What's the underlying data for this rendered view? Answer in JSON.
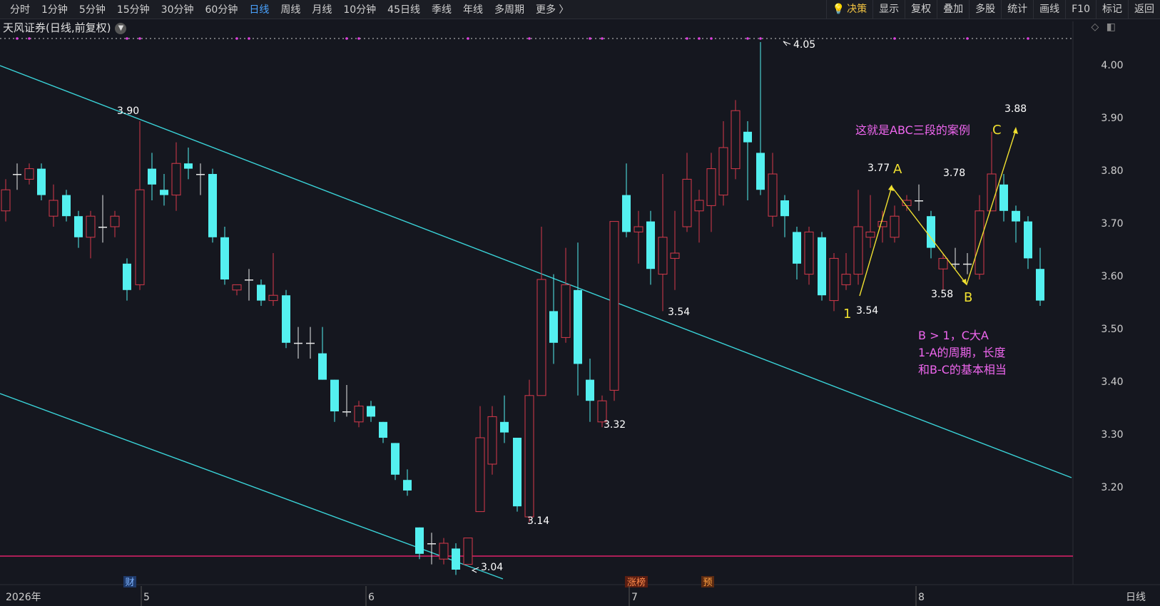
{
  "toolbar": {
    "left": [
      "分时",
      "1分钟",
      "5分钟",
      "15分钟",
      "30分钟",
      "60分钟",
      "日线",
      "周线",
      "月线",
      "10分钟",
      "45日线",
      "季线",
      "年线",
      "多周期",
      "更多 〉"
    ],
    "active_index": 6,
    "right": [
      "决策",
      "显示",
      "复权",
      "叠加",
      "多股",
      "统计",
      "画线",
      "F10",
      "标记",
      "返回"
    ],
    "decide_icon": "lightbulb-icon"
  },
  "title": {
    "text": "天风证券(日线,前复权)",
    "dropdown_icon": "chevron-down-icon"
  },
  "price_axis": {
    "ticks": [
      "4.00",
      "3.90",
      "3.80",
      "3.70",
      "3.60",
      "3.50",
      "3.40",
      "3.30",
      "3.20"
    ],
    "period_label": "日线"
  },
  "time_axis": {
    "labels": [
      "2026年",
      "5",
      "6",
      "7",
      "8"
    ]
  },
  "markers": {
    "cai": "财",
    "zhangbang": "涨榜",
    "yu": "预"
  },
  "price_labels": {
    "high_390": "3.90",
    "high_405": "4.05",
    "low_304": "3.04",
    "low_314": "3.14",
    "low_332": "3.32",
    "low_354a": "3.54",
    "low_354b": "3.54",
    "high_377": "3.77",
    "high_378": "3.78",
    "low_358": "3.58",
    "high_388": "3.88"
  },
  "wave_labels": {
    "one": "1",
    "a": "A",
    "b": "B",
    "c": "C"
  },
  "annotations": {
    "abc_title": "这就是ABC三段的案例",
    "rule_line1": "B > 1，C大A",
    "rule_line2": "1-A的周期，长度",
    "rule_line3": "和B-C的基本相当"
  },
  "colors": {
    "up": "#d63a4b",
    "down": "#54f0f0",
    "doji": "#e8e8e8",
    "trendline": "#3ad3d8",
    "support": "#e0206a",
    "wave": "#f0e030",
    "annotation": "#ee66ee"
  }
}
